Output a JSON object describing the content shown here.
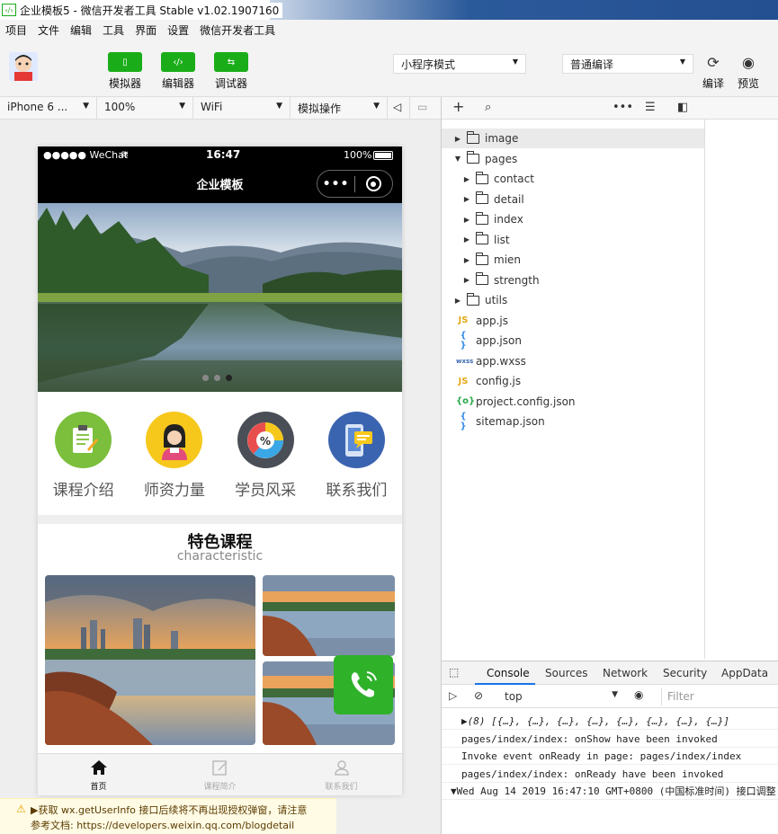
{
  "window": {
    "title": "企业模板5 - 微信开发者工具 Stable v1.02.1907160"
  },
  "menu": [
    "项目",
    "文件",
    "编辑",
    "工具",
    "界面",
    "设置",
    "微信开发者工具"
  ],
  "toolbar": {
    "simulator": "模拟器",
    "editor": "编辑器",
    "debugger": "调试器",
    "mode": "小程序模式",
    "compile_mode": "普通编译",
    "compile": "编译",
    "preview": "预览"
  },
  "devbar": {
    "device": "iPhone 6 ...",
    "zoom": "100%",
    "network": "WiFi",
    "action": "模拟操作"
  },
  "phone": {
    "status": {
      "carrier": "●●●●● WeChat",
      "time": "16:47",
      "battery": "100%"
    },
    "nav_title": "企业模板",
    "banner_dots": 3,
    "banner_active_dot": 3,
    "icons": [
      {
        "label": "课程介绍",
        "color": "#7bbf3c",
        "icon": "clipboard-icon"
      },
      {
        "label": "师资力量",
        "color": "#f7c81c",
        "icon": "teacher-icon"
      },
      {
        "label": "学员风采",
        "color": "#4a4f57",
        "icon": "pie-chart-icon"
      },
      {
        "label": "联系我们",
        "color": "#3b64b0",
        "icon": "phone-message-icon"
      }
    ],
    "section": {
      "title": "特色课程",
      "subtitle": "characteristic"
    },
    "tabs": [
      {
        "label": "首页",
        "icon": "home-icon",
        "active": true
      },
      {
        "label": "课程简介",
        "icon": "edit-icon",
        "active": false
      },
      {
        "label": "联系我们",
        "icon": "user-icon",
        "active": false
      }
    ]
  },
  "tree": [
    {
      "name": "image",
      "type": "folder",
      "depth": 0,
      "open": false
    },
    {
      "name": "pages",
      "type": "folder",
      "depth": 0,
      "open": true
    },
    {
      "name": "contact",
      "type": "folder",
      "depth": 1,
      "open": false
    },
    {
      "name": "detail",
      "type": "folder",
      "depth": 1,
      "open": false
    },
    {
      "name": "index",
      "type": "folder",
      "depth": 1,
      "open": false
    },
    {
      "name": "list",
      "type": "folder",
      "depth": 1,
      "open": false
    },
    {
      "name": "mien",
      "type": "folder",
      "depth": 1,
      "open": false
    },
    {
      "name": "strength",
      "type": "folder",
      "depth": 1,
      "open": false
    },
    {
      "name": "utils",
      "type": "folder",
      "depth": 0,
      "open": false
    },
    {
      "name": "app.js",
      "type": "js",
      "depth": 0
    },
    {
      "name": "app.json",
      "type": "json",
      "depth": 0
    },
    {
      "name": "app.wxss",
      "type": "wxss",
      "depth": 0
    },
    {
      "name": "config.js",
      "type": "js",
      "depth": 0
    },
    {
      "name": "project.config.json",
      "type": "config",
      "depth": 0
    },
    {
      "name": "sitemap.json",
      "type": "json",
      "depth": 0
    }
  ],
  "console": {
    "tabs": [
      "Console",
      "Sources",
      "Network",
      "Security",
      "AppData"
    ],
    "context": "top",
    "filter_placeholder": "Filter",
    "lines": [
      "▶(8) [{…}, {…}, {…}, {…}, {…}, {…}, {…}, {…}]",
      "pages/index/index: onShow have been invoked",
      "Invoke event onReady in page: pages/index/index",
      "pages/index/index: onReady have been invoked",
      "▼Wed Aug 14 2019 16:47:10 GMT+0800 (中国标准时间) 接口调整"
    ],
    "warning": "▶获取 wx.getUserInfo 接口后续将不再出现授权弹窗，请注意",
    "warning2": "参考文档: https://developers.weixin.qq.com/blogdetail"
  }
}
